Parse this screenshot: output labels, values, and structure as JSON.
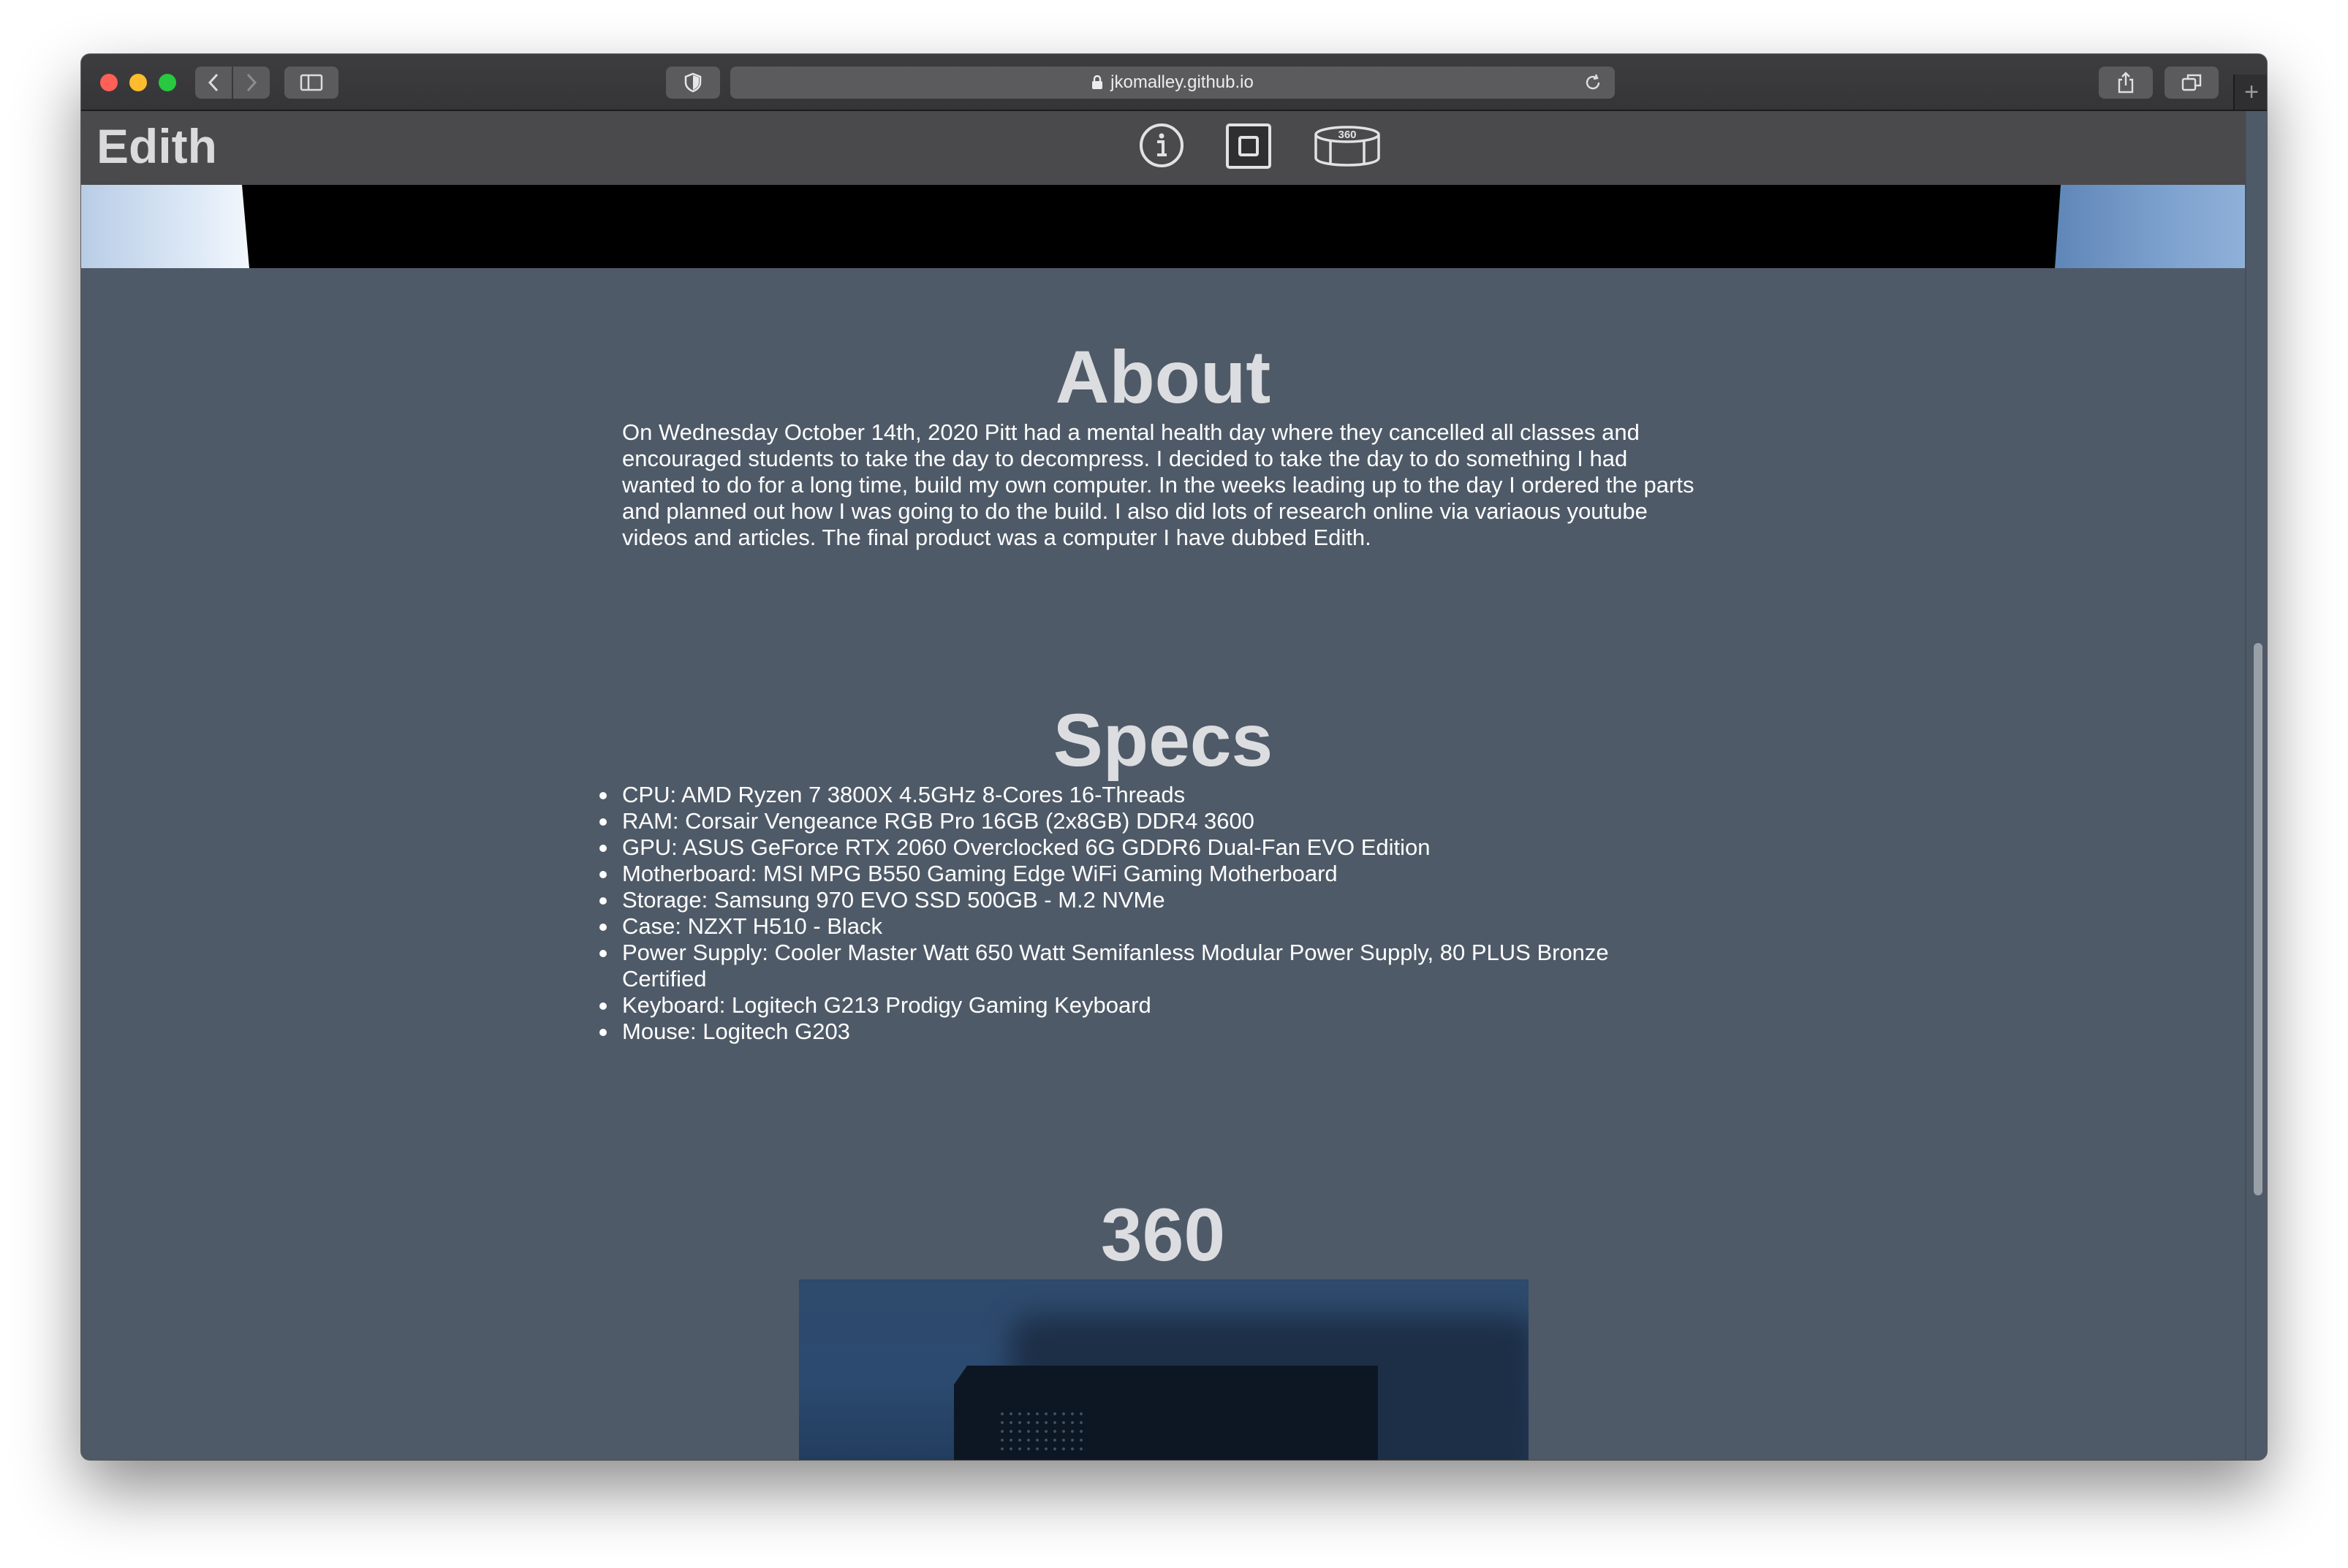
{
  "browser": {
    "url": "jkomalley.github.io"
  },
  "site": {
    "title": "Edith",
    "nav_icons": [
      "info-icon",
      "square-stop-icon",
      "panorama-360-icon"
    ],
    "nav_360_label": "360"
  },
  "about": {
    "title": "About",
    "text": "On Wednesday October 14th, 2020 Pitt had a mental health day where they cancelled all classes and encouraged students to take the day to decompress. I decided to take the day to do something I had wanted to do for a long time, build my own computer. In the weeks leading up to the day I ordered the parts and planned out how I was going to do the build. I also did lots of research online via variaous youtube videos and articles. The final product was a computer I have dubbed Edith."
  },
  "specs": {
    "title": "Specs",
    "items": [
      "CPU: AMD Ryzen 7 3800X 4.5GHz 8-Cores 16-Threads",
      "RAM: Corsair Vengeance RGB Pro 16GB (2x8GB) DDR4 3600",
      "GPU: ASUS GeForce RTX 2060 Overclocked 6G GDDR6 Dual-Fan EVO Edition",
      "Motherboard: MSI MPG B550 Gaming Edge WiFi Gaming Motherboard",
      "Storage: Samsung 970 EVO SSD 500GB - M.2 NVMe",
      "Case: NZXT H510 - Black",
      "Power Supply: Cooler Master Watt 650 Watt Semifanless Modular Power Supply, 80 PLUS Bronze Certified",
      "Keyboard: Logitech G213 Prodigy Gaming Keyboard",
      "Mouse: Logitech G203"
    ]
  },
  "view360": {
    "title": "360"
  },
  "colors": {
    "page_bg": "#4f5a68",
    "header_bg": "#4a4a4c",
    "heading": "#dcdde0",
    "body_text": "#ffffff"
  }
}
